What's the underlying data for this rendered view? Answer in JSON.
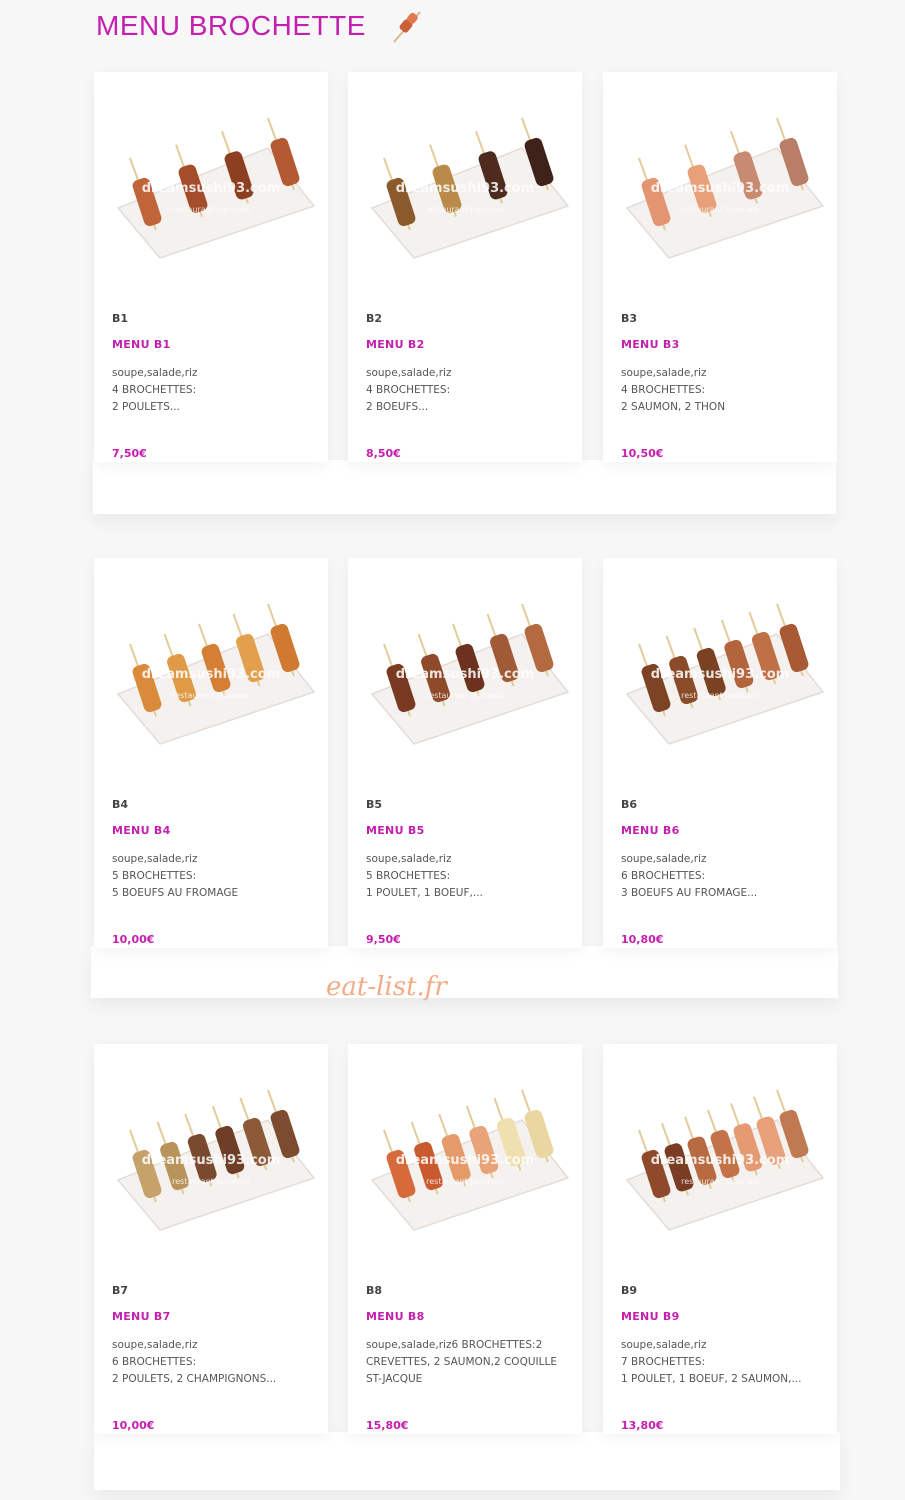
{
  "header": {
    "title": "MENU BROCHETTE",
    "icon": "skewer-icon"
  },
  "watermark": "eat-list.fr",
  "photo_watermark": {
    "main": "dreamsushi93.com",
    "sub": "restaurant japonais"
  },
  "items": [
    {
      "code": "B1",
      "name": "MENU B1",
      "desc": "soupe,salade,riz\n4 BROCHETTES:\n2 POULETS...",
      "price": "7,50€",
      "pieces": 4,
      "colors": [
        "#c0653a",
        "#a34d2a",
        "#8d3f22",
        "#b35a33"
      ]
    },
    {
      "code": "B2",
      "name": "MENU B2",
      "desc": "soupe,salade,riz\n4 BROCHETTES:\n2 BOEUFS...",
      "price": "8,50€",
      "pieces": 4,
      "colors": [
        "#8b5a2b",
        "#b98a4a",
        "#4e2b1e",
        "#3f231a"
      ]
    },
    {
      "code": "B3",
      "name": "MENU B3",
      "desc": "soupe,salade,riz\n4 BROCHETTES:\n2 SAUMON, 2 THON",
      "price": "10,50€",
      "pieces": 4,
      "colors": [
        "#e39470",
        "#e8a07a",
        "#c98a72",
        "#b97e68"
      ]
    },
    {
      "code": "B4",
      "name": "MENU B4",
      "desc": "soupe,salade,riz\n5 BROCHETTES:\n5 BOEUFS AU FROMAGE",
      "price": "10,00€",
      "pieces": 5,
      "colors": [
        "#d98a3a",
        "#e09a45",
        "#d47f35",
        "#e3a04c",
        "#cf7a30"
      ]
    },
    {
      "code": "B5",
      "name": "MENU B5",
      "desc": "soupe,salade,riz\n5 BROCHETTES:\n1 POULET, 1 BOEUF,...",
      "price": "9,50€",
      "pieces": 5,
      "colors": [
        "#7a3a22",
        "#8e4a2a",
        "#6d321e",
        "#a05a35",
        "#b36a40"
      ]
    },
    {
      "code": "B6",
      "name": "MENU B6",
      "desc": "soupe,salade,riz\n6 BROCHETTES:\n3 BOEUFS AU FROMAGE...",
      "price": "10,80€",
      "pieces": 6,
      "colors": [
        "#7c4424",
        "#8a4c28",
        "#7a4122",
        "#b2653d",
        "#c07045",
        "#a85a35"
      ]
    },
    {
      "code": "B7",
      "name": "MENU B7",
      "desc": "soupe,salade,riz\n6 BROCHETTES:\n2 POULETS, 2 CHAMPIGNONS...",
      "price": "10,00€",
      "pieces": 6,
      "colors": [
        "#c4a26a",
        "#b8935a",
        "#7a4a2e",
        "#6e3f26",
        "#8c5a38",
        "#7d4c30"
      ]
    },
    {
      "code": "B8",
      "name": "MENU B8",
      "desc": "soupe,salade,riz6 BROCHETTES:2 CREVETTES, 2 SAUMON,2 COQUILLE ST-JACQUE",
      "price": "15,80€",
      "pieces": 6,
      "colors": [
        "#d66a3a",
        "#c95a30",
        "#e59a6a",
        "#e8a478",
        "#f0e0b0",
        "#ead6a0"
      ]
    },
    {
      "code": "B9",
      "name": "MENU B9",
      "desc": "soupe,salade,riz\n7 BROCHETTES:\n1 POULET, 1 BOEUF, 2 SAUMON,...",
      "price": "13,80€",
      "pieces": 7,
      "colors": [
        "#8e4a2a",
        "#7a3c22",
        "#b86a40",
        "#c27448",
        "#e59a72",
        "#e8a07a",
        "#c07a52"
      ]
    }
  ]
}
